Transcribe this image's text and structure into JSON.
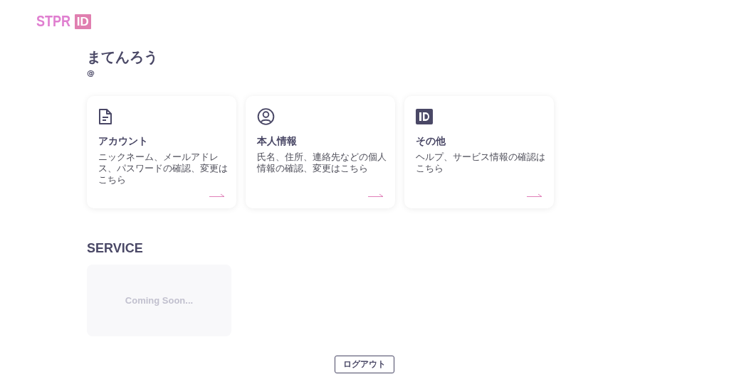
{
  "logo": {
    "text": "STPR",
    "badge": "ID"
  },
  "user": {
    "name": "まてんろう",
    "handle": "@"
  },
  "cards": [
    {
      "kind": "document",
      "title": "アカウント",
      "description": "ニックネーム、メールアドレス、パスワードの確認、変更はこちら"
    },
    {
      "kind": "person",
      "title": "本人情報",
      "description": "氏名、住所、連絡先などの個人情報の確認、変更はこちら"
    },
    {
      "kind": "id",
      "title": "その他",
      "description": "ヘルプ、サービス情報の確認はこちら"
    }
  ],
  "service": {
    "heading": "SERVICE",
    "placeholder_text": "Coming Soon..."
  },
  "logout_button": "ログアウト"
}
